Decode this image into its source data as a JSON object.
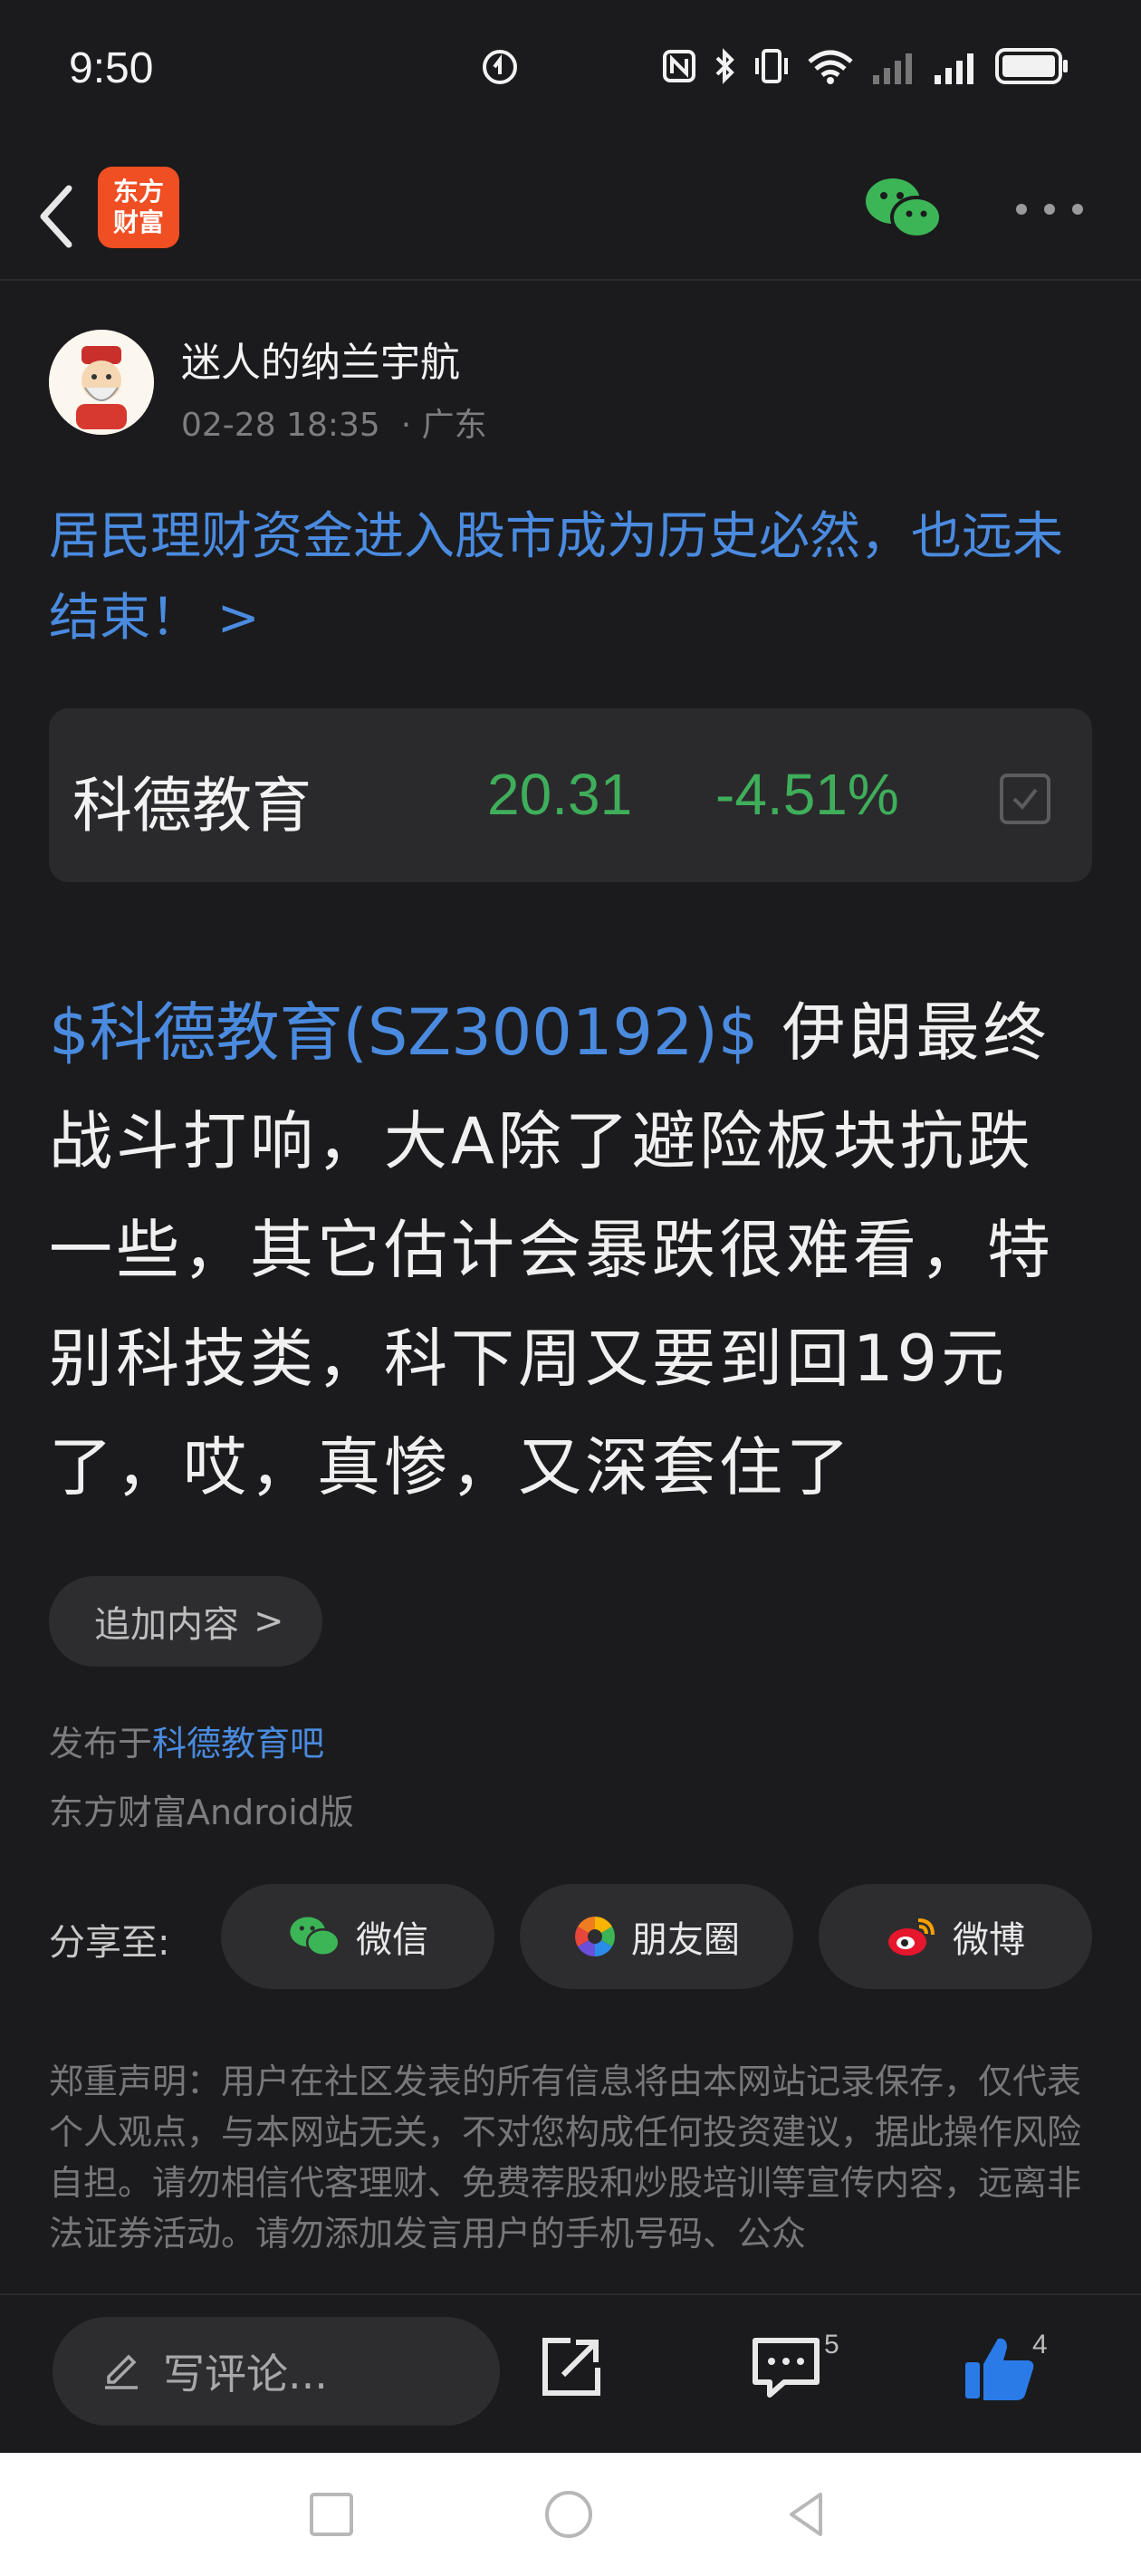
{
  "status_bar": {
    "time": "9:50",
    "icons": [
      "sync-icon",
      "nfc-icon",
      "bluetooth-icon",
      "vibrate-icon",
      "wifi-icon",
      "signal-icon",
      "signal-icon",
      "battery-icon"
    ]
  },
  "header": {
    "back_icon": "chevron-left-icon",
    "logo_text": "东方财富",
    "share_icon": "wechat-icon",
    "more_icon": "more-dots-icon"
  },
  "author": {
    "name": "迷人的纳兰宇航",
    "datetime": "02-28 18:35",
    "separator": "·",
    "location": "广东"
  },
  "post": {
    "headline_link": "居民理财资金进入股市成为历史必然，也远未结束！ >",
    "stock_tag": "$科德教育(SZ300192)$",
    "body": " 伊朗最终战斗打响，大A除了避险板块抗跌一些，其它估计会暴跌很难看，特别科技类，科下周又要到回19元了，哎，真惨，又深套住了",
    "append_label": "追加内容",
    "append_arrow": ">",
    "published_prefix": "发布于",
    "published_bar": "科德教育吧",
    "client": "东方财富Android版"
  },
  "stock_card": {
    "name": "科德教育",
    "price": "20.31",
    "change": "-4.51%",
    "change_color": "#3fae5a"
  },
  "share": {
    "label": "分享至:",
    "targets": [
      {
        "label": "微信",
        "icon": "wechat-icon"
      },
      {
        "label": "朋友圈",
        "icon": "moments-icon"
      },
      {
        "label": "微博",
        "icon": "weibo-icon"
      }
    ]
  },
  "disclaimer": "郑重声明：用户在社区发表的所有信息将由本网站记录保存，仅代表个人观点，与本网站无关，不对您构成任何投资建议，据此操作风险自担。请勿相信代客理财、免费荐股和炒股培训等宣传内容，远离非法证券活动。请勿添加发言用户的手机号码、公众",
  "bottom_bar": {
    "comment_placeholder": "写评论...",
    "share_icon": "share-out-icon",
    "comment_count": "5",
    "like_count": "4"
  },
  "colors": {
    "accent_blue": "#4a8be0",
    "down_green": "#3fae5a",
    "background": "#1b1b1d"
  }
}
